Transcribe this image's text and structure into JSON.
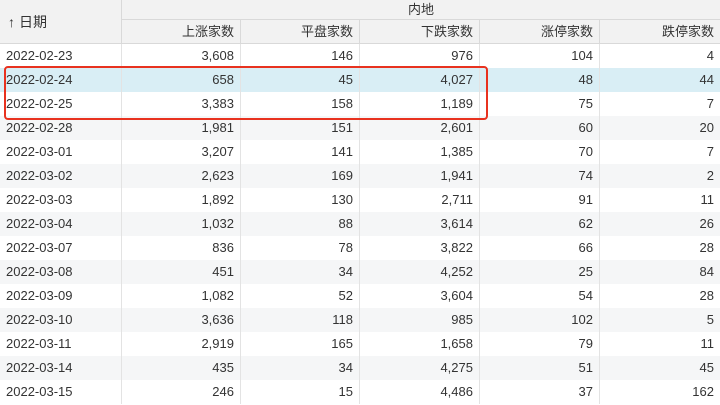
{
  "header": {
    "date_label": "日期",
    "sort_icon": "sort-up-arrow-icon",
    "sort_glyph": "↑",
    "group_label": "内地",
    "columns": [
      "上涨家数",
      "平盘家数",
      "下跌家数",
      "涨停家数",
      "跌停家数"
    ]
  },
  "rows": [
    {
      "date": "2022-02-23",
      "v": [
        "3,608",
        "146",
        "976",
        "104",
        "4"
      ]
    },
    {
      "date": "2022-02-24",
      "v": [
        "658",
        "45",
        "4,027",
        "48",
        "44"
      ]
    },
    {
      "date": "2022-02-25",
      "v": [
        "3,383",
        "158",
        "1,189",
        "75",
        "7"
      ]
    },
    {
      "date": "2022-02-28",
      "v": [
        "1,981",
        "151",
        "2,601",
        "60",
        "20"
      ]
    },
    {
      "date": "2022-03-01",
      "v": [
        "3,207",
        "141",
        "1,385",
        "70",
        "7"
      ]
    },
    {
      "date": "2022-03-02",
      "v": [
        "2,623",
        "169",
        "1,941",
        "74",
        "2"
      ]
    },
    {
      "date": "2022-03-03",
      "v": [
        "1,892",
        "130",
        "2,711",
        "91",
        "11"
      ]
    },
    {
      "date": "2022-03-04",
      "v": [
        "1,032",
        "88",
        "3,614",
        "62",
        "26"
      ]
    },
    {
      "date": "2022-03-07",
      "v": [
        "836",
        "78",
        "3,822",
        "66",
        "28"
      ]
    },
    {
      "date": "2022-03-08",
      "v": [
        "451",
        "34",
        "4,252",
        "25",
        "84"
      ]
    },
    {
      "date": "2022-03-09",
      "v": [
        "1,082",
        "52",
        "3,604",
        "54",
        "28"
      ]
    },
    {
      "date": "2022-03-10",
      "v": [
        "3,636",
        "118",
        "985",
        "102",
        "5"
      ]
    },
    {
      "date": "2022-03-11",
      "v": [
        "2,919",
        "165",
        "1,658",
        "79",
        "11"
      ]
    },
    {
      "date": "2022-03-14",
      "v": [
        "435",
        "34",
        "4,275",
        "51",
        "45"
      ]
    },
    {
      "date": "2022-03-15",
      "v": [
        "246",
        "15",
        "4,486",
        "37",
        "162"
      ]
    }
  ],
  "selected_row_index": 1,
  "highlight_color": "#e8321f",
  "selected_row_color": "#d9eef5"
}
